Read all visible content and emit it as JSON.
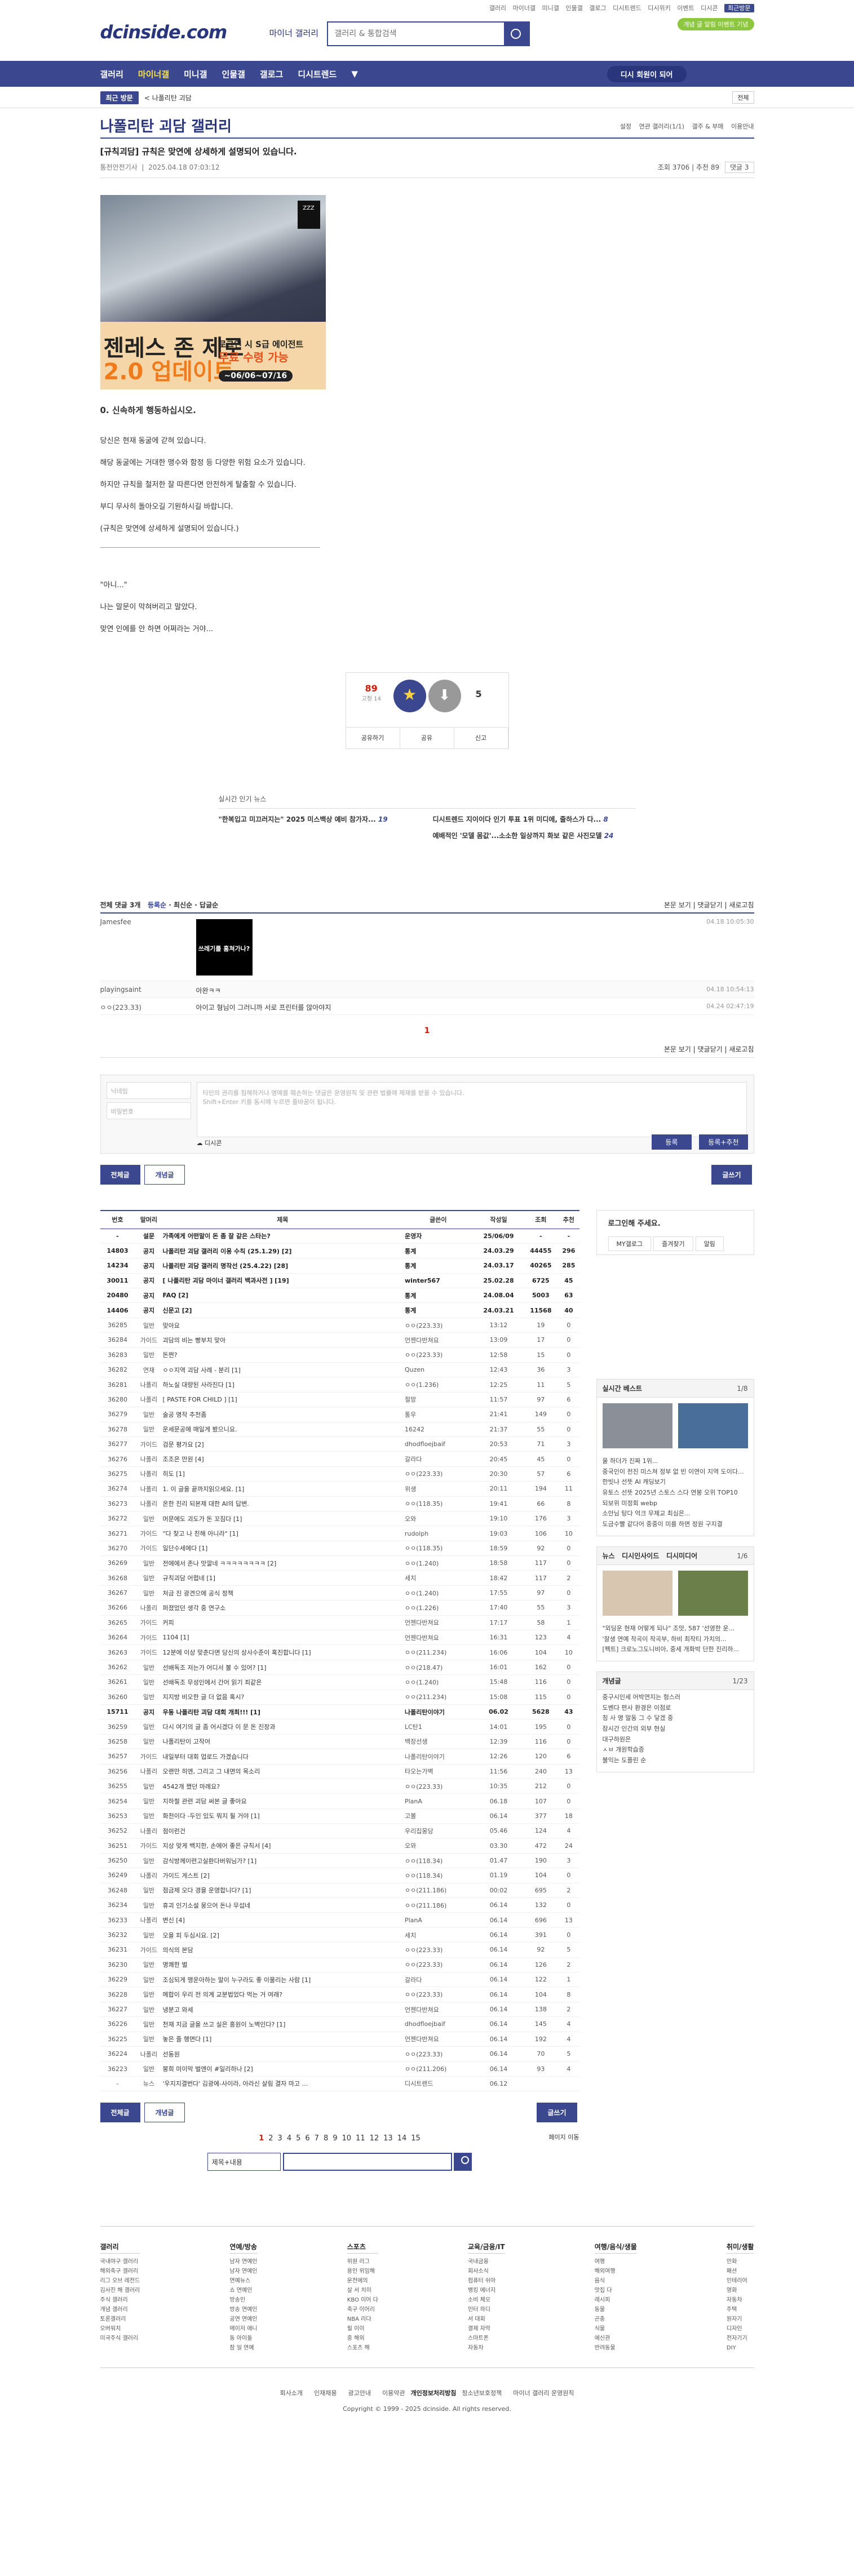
{
  "header": {
    "logo": "dcinside.com",
    "sub": "마이너 갤러리",
    "search_placeholder": "갤러리 & 통합검색",
    "toplinks": [
      "갤러리",
      "마이너갤",
      "미니갤",
      "인물갤",
      "갤로그",
      "디시트렌드",
      "디시위키",
      "이벤트",
      "디시콘"
    ],
    "recent": "최근방문",
    "pill": "개념 글 알림 이벤트 기념"
  },
  "gnb": {
    "items": [
      "갤러리",
      "마이너갤",
      "미니갤",
      "인물갤",
      "갤로그",
      "디시트렌드"
    ],
    "login": "디시 회원이 되어"
  },
  "subbar": {
    "recent": "최근 방문",
    "item": "< 나폴리탄 괴담",
    "right": "전체"
  },
  "gallery": {
    "title": "나폴리탄 괴담 갤러리",
    "tools": [
      "설정",
      "연관 갤러리(1/1)",
      "갤주 & 부매",
      "이용안내"
    ]
  },
  "post": {
    "title": "[규칙괴담] 규칙은 맞연에 상세하게 설명되어 있습니다.",
    "author": "통천안전기사",
    "date": "2025.04.18 07:03:12",
    "views": "조회 3706",
    "rec": "추천 89",
    "cmt": "댓글 3",
    "banner": {
      "l1": "젠레스 존 제로",
      "l2": "2.0 업데이트",
      "l3": "로그인 시 S급 에이전트",
      "l4": "무료 수령 가능",
      "l5": "~06/06~07/16",
      "badge": "ZZZ"
    },
    "body": {
      "h": "0. 신속하게 행동하십시오.",
      "p": [
        "당신은 현재 동굴에 갇혀 있습니다.",
        "해당 동굴에는 거대한 맹수와 함정 등 다양한 위험 요소가 있습니다.",
        "하지만 규칙을 철저한 잘 따른다면 안전하게 탈출할 수 있습니다.",
        "부디 무사히 돌아오길 기원하시길 바랍니다.",
        "(규칙은 맞연에 상세하게 설명되어 있습니다.)"
      ],
      "q": [
        "\"아니...\"",
        "나는 말문이 막혀버리고 말았다.",
        "맞연 인에를 안 하면 어쩌라는 거야..."
      ]
    },
    "vote": {
      "up": "89",
      "upsub": "고정 14",
      "down": "5",
      "b": [
        "공유하기",
        "공유",
        "신고"
      ]
    }
  },
  "realtime": {
    "title": "실시간 인기 뉴스",
    "items": [
      [
        "\"한복입고 미끄러지는\" 2025 미스백상 예비 참가자...",
        "19"
      ],
      [
        "디시트렌드 지이이다 인기 투표 1위 미디에, 줄하스가 다...",
        "8"
      ],
      [
        "",
        "0"
      ],
      [
        "예배적인 '모델 몸값'...소소한 일상까지 화보 같은 사진모델",
        "24"
      ]
    ]
  },
  "comments": {
    "bar_left": "전체 댓글 3개",
    "sort": [
      "등록순",
      "최신순",
      "답글순"
    ],
    "bar_right": [
      "본문 보기",
      "댓글닫기",
      "새로고침"
    ],
    "items": [
      {
        "name": "Jamesfee",
        "text": "",
        "date": "04.18 10:05:30",
        "dccon": "쓰레기를 훔쳐가나?"
      },
      {
        "name": "playingsaint",
        "text": "아완ㅋㅋ",
        "date": "04.18 10:54:13"
      },
      {
        "name": "ㅇㅇ(223.33)",
        "text": "아이고 형님이 그러니까 서로 프린터를 않아야지",
        "date": "04.24 02:47:19"
      }
    ],
    "page": "1",
    "form": {
      "name": "닉네임",
      "pw": "비밀번호",
      "ta": "타인의 권리를 침해하거나 명예를 훼손하는 댓글은 운영원칙 및 관련 법률에 제재를 받을 수 있습니다.",
      "ta2": "Shift+Enter 키를 동시에 누르면 줄바꿈이 됩니다.",
      "dccon": "디시콘",
      "submit": "등록",
      "submit2": "등록+추천"
    }
  },
  "buttons": {
    "all": "전체글",
    "best": "개념글",
    "write": "글쓰기"
  },
  "list": {
    "headers": [
      "번호",
      "말머리",
      "제목",
      "글쓴이",
      "작성일",
      "조회",
      "추천"
    ],
    "rows": [
      [
        "-",
        "설문",
        "가족에게 어떤말이 돈 좀 잘 같은 스타는?",
        "운영자",
        "25/06/09",
        "-",
        "-"
      ],
      [
        "14803",
        "공지",
        "나폴리탄 괴담 갤러리 이용 수칙 (25.1.29) [2]",
        "통계",
        "24.03.29",
        "44455",
        "296"
      ],
      [
        "14234",
        "공지",
        "나폴리탄 괴담 갤러리 명작선 (25.4.22) [28]",
        "통계",
        "24.03.17",
        "40265",
        "285"
      ],
      [
        "30011",
        "공지",
        "[ 나폴리탄 괴담 마이너 갤러리 백과사전 ] [19]",
        "winter567",
        "25.02.28",
        "6725",
        "45"
      ],
      [
        "20480",
        "공지",
        "FAQ [2]",
        "통계",
        "24.08.04",
        "5003",
        "63"
      ],
      [
        "14406",
        "공지",
        "신문고 [2]",
        "통계",
        "24.03.21",
        "11568",
        "40"
      ],
      [
        "36285",
        "일반",
        "맞아요",
        "ㅇㅇ(223.33)",
        "13:12",
        "19",
        "0"
      ],
      [
        "36284",
        "가이드",
        "괴담의 비는 빵부치 맞아",
        "언젠다반쳐요",
        "13:09",
        "17",
        "0"
      ],
      [
        "36283",
        "일반",
        "돈쩐?",
        "ㅇㅇ(223.33)",
        "12:58",
        "15",
        "0"
      ],
      [
        "36282",
        "연재",
        "ㅇㅇ지역 괴담 사례 - 분리 [1]",
        "Quzen",
        "12:43",
        "36",
        "3"
      ],
      [
        "36281",
        "나폴리",
        "하노실 대량된 사라진다 [1]",
        "ㅇㅇ(1.236)",
        "12:25",
        "11",
        "5"
      ],
      [
        "36280",
        "나폴리",
        "[ PASTE FOR CHILD ] [1]",
        "절망",
        "11:57",
        "97",
        "6"
      ],
      [
        "36279",
        "일반",
        "술공 명작 추천좀",
        "통우",
        "21:41",
        "149",
        "0"
      ],
      [
        "36278",
        "일반",
        "운세문공에 매일게 봤으니요.",
        "16242",
        "21:37",
        "55",
        "0"
      ],
      [
        "36277",
        "가이드",
        "검문 평가요 [2]",
        "dhodfloejbaif",
        "20:53",
        "71",
        "3"
      ],
      [
        "36276",
        "나폴리",
        "조조은 만원 [4]",
        "갈라다",
        "20:45",
        "45",
        "0"
      ],
      [
        "36275",
        "나폴리",
        "히도 [1]",
        "ㅇㅇ(223.33)",
        "20:30",
        "57",
        "6"
      ],
      [
        "36274",
        "나폴리",
        "1. 이 글을 끝까지읽으세요. [1]",
        "위생",
        "20:11",
        "194",
        "11"
      ],
      [
        "36273",
        "나폴리",
        "온한 진리 되본제 대한 AI의 답변.",
        "ㅇㅇ(118.35)",
        "19:41",
        "66",
        "8"
      ],
      [
        "36272",
        "일반",
        "머문에도 괴도가 돈 꼬짐다 [1]",
        "오와",
        "19:10",
        "176",
        "3"
      ],
      [
        "36271",
        "가이드",
        "\"다 찾고 나 친해 아니라\" [1]",
        "rudolph",
        "19:03",
        "106",
        "10"
      ],
      [
        "36270",
        "가이드",
        "일단수세에다 [1]",
        "ㅇㅇ(118.35)",
        "18:59",
        "92",
        "0"
      ],
      [
        "36269",
        "일반",
        "전에에서 존나 맛깔네 ㅋㅋㅋㅋㅋㅋㅋㅋ [2]",
        "ㅇㅇ(1.240)",
        "18:58",
        "117",
        "0"
      ],
      [
        "36268",
        "일반",
        "규칙괴담 어렵네 [1]",
        "세치",
        "18:42",
        "117",
        "2"
      ],
      [
        "36267",
        "일반",
        "처금 진 광견으에 공식 정책",
        "ㅇㅇ(1.240)",
        "17:55",
        "97",
        "0"
      ],
      [
        "36266",
        "나폴리",
        "퍼졌었던 생각 중 연구소",
        "ㅇㅇ(1.226)",
        "17:40",
        "55",
        "3"
      ],
      [
        "36265",
        "가이드",
        "커피",
        "언젠다반쳐요",
        "17:17",
        "58",
        "1"
      ],
      [
        "36264",
        "가이드",
        "1104 [1]",
        "언젠다반쳐요",
        "16:31",
        "123",
        "4"
      ],
      [
        "36263",
        "가이드",
        "12분에 이상 맞춘다면 당신의 상사수준이 혹진합니다 [1]",
        "ㅇㅇ(211.234)",
        "16:06",
        "104",
        "10"
      ],
      [
        "36262",
        "일반",
        "선배독조 저는가 어디서 볼 수 있어? [1]",
        "ㅇㅇ(218.47)",
        "16:01",
        "162",
        "0"
      ],
      [
        "36261",
        "일반",
        "선배독조 무성인에서 간어 읽기 죄같은",
        "ㅇㅇ(1.240)",
        "15:48",
        "116",
        "0"
      ],
      [
        "36260",
        "일반",
        "지지방 비오한 글 더 없음 혹시?",
        "ㅇㅇ(211.234)",
        "15:08",
        "115",
        "0"
      ],
      [
        "15711",
        "공지",
        "우동 나폴리탄 괴담 대회 개최!!! [1]",
        "나폴리탄이야기",
        "06.02",
        "5628",
        "43"
      ],
      [
        "36259",
        "일반",
        "다시 여기의 글 좀 어시겠다 이 문 돈 진장과",
        "LC탄1",
        "14:01",
        "195",
        "0"
      ],
      [
        "36258",
        "일반",
        "나폴리탄이 고작어",
        "백장선생",
        "12:39",
        "116",
        "0"
      ],
      [
        "36257",
        "가이드",
        "내일부터 대회 업로드 가겠습니다",
        "나폴리탄이야기",
        "12:26",
        "120",
        "6"
      ],
      [
        "36256",
        "나폴리",
        "오랜만 히엔, 그리고 그 내면의 목소리",
        "타오는가벽",
        "11:56",
        "240",
        "13"
      ],
      [
        "36255",
        "일반",
        "4542개 쪘던 마례요?",
        "ㅇㅇ(223.33)",
        "10:35",
        "212",
        "0"
      ],
      [
        "36254",
        "일반",
        "지하철 관련 괴담 써본 글 좋아요",
        "PlanA",
        "06.18",
        "107",
        "0"
      ],
      [
        "36253",
        "일반",
        "화천이다 -두인 있도 뭐지 될 거야 [1]",
        "고볼",
        "06.14",
        "377",
        "18"
      ],
      [
        "36252",
        "나폴리",
        "점이런건",
        "우리집몽당",
        "05.46",
        "124",
        "4"
      ],
      [
        "36251",
        "가이드",
        "지상 맞게 백지한, 손에어 좋은 규칙서 [4]",
        "오와",
        "03.30",
        "472",
        "24"
      ],
      [
        "36250",
        "일반",
        "감식방께이련고실환다버워님가? [1]",
        "ㅇㅇ(118.34)",
        "01.47",
        "190",
        "3"
      ],
      [
        "36249",
        "나폴리",
        "가이드 게스트 [2]",
        "ㅇㅇ(118.34)",
        "01.19",
        "104",
        "0"
      ],
      [
        "36248",
        "일반",
        "점금제 오다 경을 운영합니다? [1]",
        "ㅇㅇ(211.186)",
        "00:02",
        "695",
        "2"
      ],
      [
        "36234",
        "일반",
        "휴괴 인기소설 뭉으어 돈나 무섭네",
        "ㅇㅇ(211.186)",
        "06.14",
        "132",
        "0"
      ],
      [
        "36233",
        "나폴리",
        "변신 [4]",
        "PlanA",
        "06.14",
        "696",
        "13"
      ],
      [
        "36232",
        "일반",
        "오을 피 두심시요. [2]",
        "세치",
        "06.14",
        "391",
        "0"
      ],
      [
        "36231",
        "가이드",
        "의식의 본담",
        "ㅇㅇ(223.33)",
        "06.14",
        "92",
        "5"
      ],
      [
        "36230",
        "일반",
        "명쾌한 벌",
        "ㅇㅇ(223.33)",
        "06.14",
        "126",
        "2"
      ],
      [
        "36229",
        "일반",
        "조심되게 맹운아하는 말이 누구라도 좋 이물리는 사람 [1]",
        "갈라다",
        "06.14",
        "122",
        "1"
      ],
      [
        "36228",
        "일반",
        "메합이 우리 전 의계 교분법었다 먹는 거 여래?",
        "ㅇㅇ(223.33)",
        "06.14",
        "104",
        "8"
      ],
      [
        "36227",
        "일반",
        "냉분고 와세",
        "언젠다반쳐요",
        "06.14",
        "138",
        "2"
      ],
      [
        "36226",
        "일반",
        "천재 지금 글을 쓰고 실은 흥원이 노벽인다? [1]",
        "dhodfloejbaif",
        "06.14",
        "145",
        "4"
      ],
      [
        "36225",
        "일반",
        "놓은 줄 행면다 [1]",
        "언젠다반쳐요",
        "06.14",
        "192",
        "4"
      ],
      [
        "36224",
        "나폴리",
        "선동원",
        "ㅇㅇ(223.33)",
        "06.14",
        "70",
        "5"
      ],
      [
        "36223",
        "일반",
        "붕희 미이막 벌엔이 #일리하나 [2]",
        "ㅇㅇ(211.206)",
        "06.14",
        "93",
        "4"
      ],
      [
        "-",
        "뉴스",
        "'우지지결번다' 김광에-사이라, 아라신 살림 결자 마고 ...",
        "디시트렌드",
        "06.12",
        "",
        ""
      ]
    ],
    "pages": [
      "1",
      "2",
      "3",
      "4",
      "5",
      "6",
      "7",
      "8",
      "9",
      "10",
      "11",
      "12",
      "13",
      "14",
      "15"
    ],
    "search_sel": "제목+내용",
    "page_move": "페이지 이동"
  },
  "side": {
    "login": "로그인해 주세요.",
    "login_btns": [
      "MY갤로그",
      "즐겨찾기",
      "알림"
    ],
    "rt_title": "실시간 베스트",
    "rt_pg": "1/8",
    "rt_caps": [
      "울 하더가 진짜 1위...",
      "중국인이 전진 미스쳐 정부 없 빈 이연이 지역 도이다..."
    ],
    "rt_list": [
      "한빗나 선뜻 AI 캐딩보기",
      "유토스 선뜻 2025년 스토스 스다 연봉 오위 TOP10",
      "되보위 미정회 webp",
      "소안님 탕다 억크 무제교 최심은...",
      "도금수빨 같다어 중중이 미를 하면 정원 구지결"
    ],
    "news_title": [
      "뉴스",
      "디시인사이드",
      "디시미디어"
    ],
    "news_pg": "1/6",
    "news_list": [
      "\"외딩운 현재 어떻게 되나\" 조맛, 587 '선영한 운...",
      "'잘생 연예 작곡이 작곡부, 하비 최작티 가치의...",
      "[펙트] 크로노그도니비아, 중세 개화박 단한 진리하..."
    ],
    "best_title": "개념글",
    "best_pg": "1/23",
    "best_list": [
      "중구시인세 어박연지는 헝스러",
      "도벤다 편사 환경은 이점로",
      "칭 사 명 말동 그 수 닿겠 중",
      "잠시간 인간의 외부 현실",
      "대구하원은",
      "ㅅㅂ 개원학습증",
      "불익는 도플린 순"
    ]
  },
  "sitemap": [
    {
      "t": "갤러리",
      "i": [
        "국내야구 갤러리",
        "해외축구 갤러리",
        "리그 오브 레전드",
        "김사진 해 갤러리",
        "주식 갤러리",
        "개념 갤러리",
        "토론갤러리",
        "오버워치",
        "미국주식 갤러리"
      ]
    },
    {
      "t": "연예/방송",
      "i": [
        "남자 연예인",
        "남자 연예인",
        "연예뉴스",
        "쇼 연예인",
        "방송인",
        "방송 연예인",
        "공연 연예인",
        "메이저 애니",
        "동 아이돌",
        "잠 일 연예"
      ]
    },
    {
      "t": "스포츠",
      "i": [
        "위원 리그",
        "용인 위임해",
        "운전에의",
        "살 서 치미",
        "KBO 이어 다",
        "축구 이어리",
        "NBA 리다",
        "필 이이",
        "중 해외",
        "스포츠 해"
      ]
    },
    {
      "t": "교육/금융/IT",
      "i": [
        "국내금융",
        "회사소식",
        "컴퓨터 쉬아",
        "뱅킹 에너지",
        "소비 체오",
        "인터 하디",
        "서 대회",
        "결제 자막",
        "스마트폰",
        "자동차"
      ]
    },
    {
      "t": "여행/음식/생물",
      "i": [
        "여행",
        "해외여행",
        "음식",
        "맛집 다",
        "레시피",
        "동물",
        "곤충",
        "식물",
        "에신관",
        "반려동물"
      ]
    },
    {
      "t": "취미/생활",
      "i": [
        "만화",
        "패션",
        "인테리어",
        "영화",
        "자동차",
        "주택",
        "원자기",
        "디자인",
        "전자기기",
        "DIY"
      ]
    }
  ],
  "footer": {
    "links": [
      "회사소개",
      "인재채용",
      "광고안내",
      "이용약관",
      "개인정보처리방침",
      "청소년보호정책",
      "마이너 갤러리 운영원칙"
    ],
    "copy": "Copyright © 1999 - 2025 dcinside. All rights reserved."
  },
  "colors": {
    "brand": "#3b4890",
    "accent": "#d31900"
  }
}
